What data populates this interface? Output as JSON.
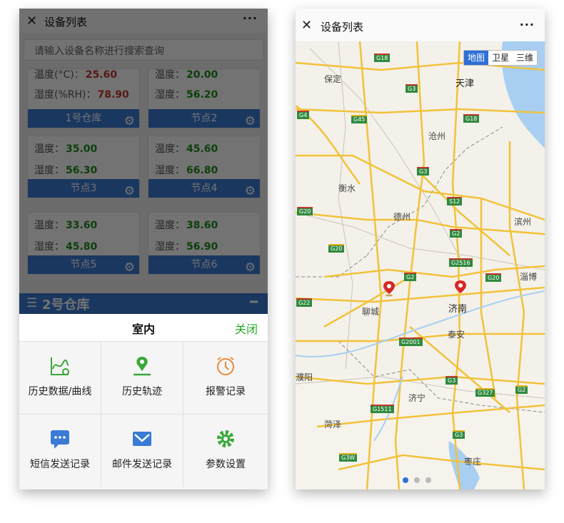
{
  "left": {
    "title": "设备列表",
    "close_glyph": "✕",
    "more_glyph": "···",
    "search_placeholder": "请输入设备名称进行搜索查询",
    "temp_label": "温度：",
    "hum_label": "湿度：",
    "temp_label_c": "温度(°C)：",
    "hum_label_rh": "湿度(%RH)：",
    "cards": [
      {
        "name": "1号仓库",
        "temp": "25.60",
        "hum": "78.90",
        "alarm": true
      },
      {
        "name": "节点2",
        "temp": "20.00",
        "hum": "56.20",
        "alarm": false
      },
      {
        "name": "节点3",
        "temp": "35.00",
        "hum": "56.30",
        "alarm": false
      },
      {
        "name": "节点4",
        "temp": "45.60",
        "hum": "66.80",
        "alarm": false
      },
      {
        "name": "节点5",
        "temp": "33.60",
        "hum": "45.80",
        "alarm": false
      },
      {
        "name": "节点6",
        "temp": "38.60",
        "hum": "56.90",
        "alarm": false
      }
    ],
    "group": {
      "title": "2号仓库",
      "collapse_glyph": "━",
      "list_glyph": "☰"
    },
    "sheet": {
      "title": "室内",
      "close": "关闭",
      "items": [
        {
          "label": "历史数据/曲线",
          "icon": "chart-line-icon"
        },
        {
          "label": "历史轨迹",
          "icon": "location-pin-icon"
        },
        {
          "label": "报警记录",
          "icon": "alarm-clock-icon"
        },
        {
          "label": "短信发送记录",
          "icon": "sms-message-icon"
        },
        {
          "label": "邮件发送记录",
          "icon": "email-icon"
        },
        {
          "label": "参数设置",
          "icon": "gear-icon"
        }
      ]
    },
    "colors": {
      "accent": "#3a7bd5",
      "close": "#27a827",
      "normal_value": "#1e8c1e",
      "alarm_value": "#c0392b"
    }
  },
  "right": {
    "title": "设备列表",
    "close_glyph": "✕",
    "more_glyph": "···",
    "map_tabs": [
      {
        "label": "地图",
        "active": true
      },
      {
        "label": "卫星",
        "active": false
      },
      {
        "label": "三维",
        "active": false
      }
    ],
    "cities": [
      {
        "name": "天津",
        "big": true
      },
      {
        "name": "保定"
      },
      {
        "name": "沧州"
      },
      {
        "name": "衡水"
      },
      {
        "name": "德州"
      },
      {
        "name": "滨州"
      },
      {
        "name": "淄博"
      },
      {
        "name": "聊城"
      },
      {
        "name": "济南",
        "big": true
      },
      {
        "name": "泰安"
      },
      {
        "name": "济宁"
      },
      {
        "name": "菏泽"
      },
      {
        "name": "枣庄"
      },
      {
        "name": "濮阳"
      }
    ],
    "highways": [
      "G18",
      "G3",
      "G4",
      "G45",
      "G18",
      "G3",
      "S12",
      "G20",
      "G2",
      "G20",
      "G2516",
      "G2",
      "G20",
      "G22",
      "G2001",
      "G3",
      "G327",
      "G2",
      "G1511",
      "G3",
      "G3W"
    ],
    "pager": {
      "count": 3,
      "active": 0
    }
  }
}
